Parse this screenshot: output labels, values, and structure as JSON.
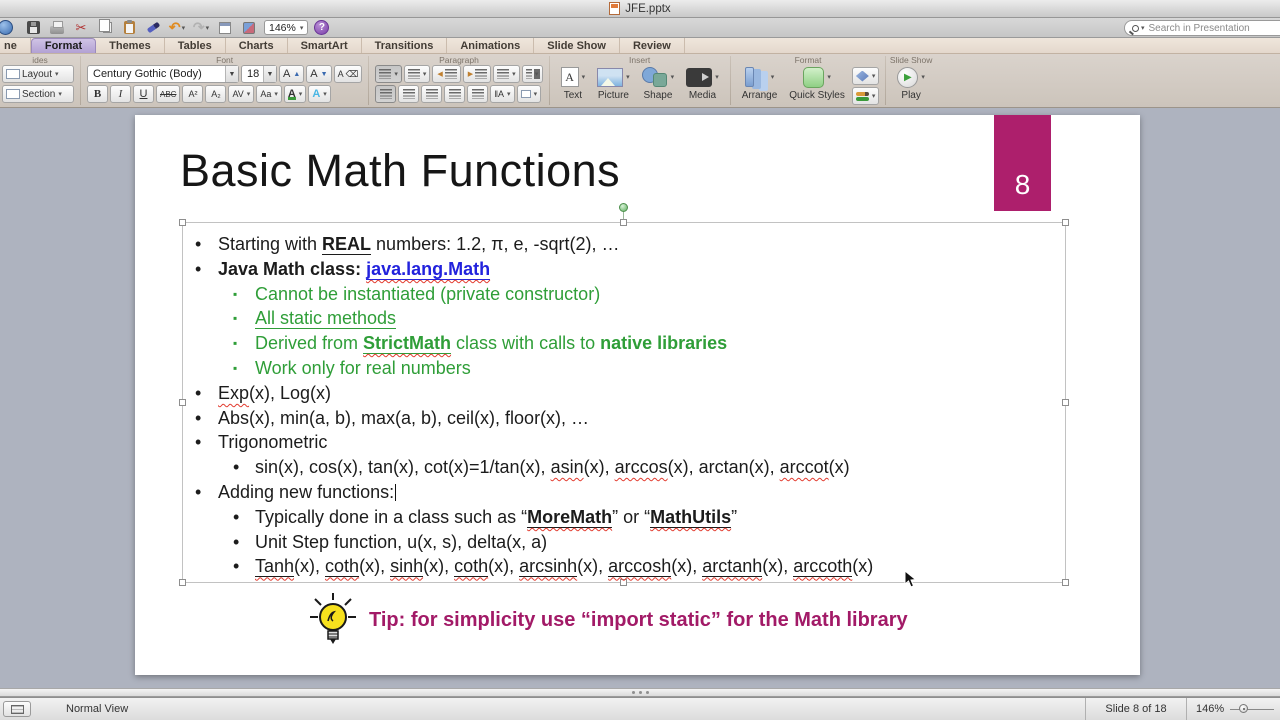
{
  "titlebar": {
    "title": "JFE.pptx"
  },
  "toolbar": {
    "zoom_value": "146%"
  },
  "search": {
    "placeholder": "Search in Presentation"
  },
  "ribbon": {
    "tabs": [
      "ne",
      "Format",
      "Themes",
      "Tables",
      "Charts",
      "SmartArt",
      "Transitions",
      "Animations",
      "Slide Show",
      "Review"
    ],
    "selected_tab": "Format",
    "groups": {
      "slides": {
        "label": "ides",
        "layout_label": "Layout",
        "section_label": "Section"
      },
      "font": {
        "label": "Font",
        "font_name": "Century Gothic (Body)",
        "font_size": "18",
        "buttons": [
          "B",
          "I",
          "U",
          "ABC",
          "A²",
          "A₂",
          "AV",
          "Aa",
          "A",
          "A"
        ]
      },
      "paragraph": {
        "label": "Paragraph"
      },
      "insert": {
        "label": "Insert",
        "items": [
          "Text",
          "Picture",
          "Shape",
          "Media"
        ]
      },
      "format": {
        "label": "Format",
        "arrange_label": "Arrange",
        "quick_styles_label": "Quick Styles"
      },
      "slideshow": {
        "label": "Slide Show",
        "play_label": "Play"
      }
    }
  },
  "colors": {
    "accent_magenta": "#ad1f6c",
    "green_text": "#2f9e38",
    "link_blue": "#2222dd",
    "tip_magenta": "#a21a67"
  },
  "slide": {
    "title": "Basic Math Functions",
    "number": "8",
    "tip": "Tip: for simplicity use “import static” for the Math library",
    "bullets": [
      {
        "level": 1,
        "m": "•",
        "segs": [
          {
            "t": "Starting with "
          },
          {
            "t": "REAL",
            "b": 1,
            "u": 1
          },
          {
            "t": " numbers: 1.2, π, e, -sqrt(2), …"
          }
        ]
      },
      {
        "level": 1,
        "m": "•",
        "segs": [
          {
            "t": "Java Math class: ",
            "b": 1
          },
          {
            "t": "java.lang.Math",
            "b": 1,
            "u": 1,
            "sq": 1,
            "color": "#2222dd"
          }
        ]
      },
      {
        "level": 2,
        "m": "▪",
        "color": "#2f9e38",
        "segs": [
          {
            "t": "Cannot be instantiated (private constructor)"
          }
        ]
      },
      {
        "level": 2,
        "m": "▪",
        "color": "#2f9e38",
        "segs": [
          {
            "t": "All static methods",
            "u": 1
          }
        ]
      },
      {
        "level": 2,
        "m": "▪",
        "color": "#2f9e38",
        "segs": [
          {
            "t": "Derived from "
          },
          {
            "t": "StrictMath",
            "b": 1,
            "u": 1,
            "sq": 1
          },
          {
            "t": " class with calls to "
          },
          {
            "t": "native libraries",
            "b": 1
          }
        ]
      },
      {
        "level": 2,
        "m": "▪",
        "color": "#2f9e38",
        "segs": [
          {
            "t": "Work only for real numbers"
          }
        ]
      },
      {
        "level": 1,
        "m": "•",
        "segs": [
          {
            "t": "Exp",
            "sq": 1
          },
          {
            "t": "(x), Log(x)"
          }
        ]
      },
      {
        "level": 1,
        "m": "•",
        "segs": [
          {
            "t": "Abs(x), min(a, b), max(a, b), ceil(x), floor(x), …"
          }
        ]
      },
      {
        "level": 1,
        "m": "•",
        "segs": [
          {
            "t": "Trigonometric"
          }
        ]
      },
      {
        "level": 2,
        "m": "•",
        "segs": [
          {
            "t": "sin(x), cos(x), tan(x), cot(x)=1/tan(x), "
          },
          {
            "t": "asin",
            "sq": 1
          },
          {
            "t": "(x), "
          },
          {
            "t": "arccos",
            "sq": 1
          },
          {
            "t": "(x), arctan(x), "
          },
          {
            "t": "arccot",
            "sq": 1
          },
          {
            "t": "(x)"
          }
        ]
      },
      {
        "level": 1,
        "m": "•",
        "segs": [
          {
            "t": "Adding new functions:"
          },
          {
            "t": "",
            "caret": 1
          }
        ]
      },
      {
        "level": 2,
        "m": "•",
        "segs": [
          {
            "t": "Typically done in a class such as “"
          },
          {
            "t": "MoreMath",
            "b": 1,
            "u": 1,
            "sq": 1
          },
          {
            "t": "” or “"
          },
          {
            "t": "MathUtils",
            "b": 1,
            "u": 1,
            "sq": 1
          },
          {
            "t": "”"
          }
        ]
      },
      {
        "level": 2,
        "m": "•",
        "segs": [
          {
            "t": "Unit Step function, u(x, s), delta(x, a)"
          }
        ]
      },
      {
        "level": 2,
        "m": "•",
        "segs": [
          {
            "t": "Tanh",
            "u": 1,
            "sq": 1
          },
          {
            "t": "(x), "
          },
          {
            "t": "coth",
            "u": 1,
            "sq": 1
          },
          {
            "t": "(x), "
          },
          {
            "t": "sinh",
            "u": 1,
            "sq": 1
          },
          {
            "t": "(x), "
          },
          {
            "t": "coth",
            "u": 1,
            "sq": 1
          },
          {
            "t": "(x), "
          },
          {
            "t": "arcsinh",
            "u": 1,
            "sq": 1
          },
          {
            "t": "(x), "
          },
          {
            "t": "arccosh",
            "u": 1,
            "sq": 1
          },
          {
            "t": "(x), "
          },
          {
            "t": "arctanh",
            "u": 1,
            "sq": 1
          },
          {
            "t": "(x), "
          },
          {
            "t": "arccoth",
            "u": 1,
            "sq": 1
          },
          {
            "t": "(x)"
          }
        ]
      }
    ]
  },
  "statusbar": {
    "view_label": "Normal View",
    "slide_position": "Slide 8 of 18",
    "zoom_value": "146%"
  }
}
